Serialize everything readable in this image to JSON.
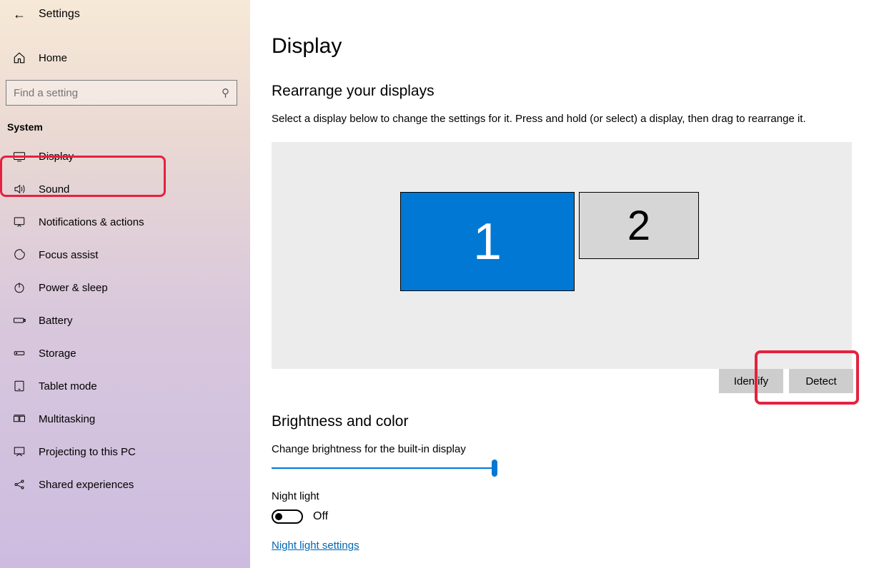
{
  "app": {
    "title": "Settings"
  },
  "sidebar": {
    "home": "Home",
    "search_placeholder": "Find a setting",
    "category": "System",
    "items": [
      {
        "label": "Display"
      },
      {
        "label": "Sound"
      },
      {
        "label": "Notifications & actions"
      },
      {
        "label": "Focus assist"
      },
      {
        "label": "Power & sleep"
      },
      {
        "label": "Battery"
      },
      {
        "label": "Storage"
      },
      {
        "label": "Tablet mode"
      },
      {
        "label": "Multitasking"
      },
      {
        "label": "Projecting to this PC"
      },
      {
        "label": "Shared experiences"
      }
    ]
  },
  "main": {
    "title": "Display",
    "rearrange_title": "Rearrange your displays",
    "rearrange_desc": "Select a display below to change the settings for it. Press and hold (or select) a display, then drag to rearrange it.",
    "monitor1": "1",
    "monitor2": "2",
    "identify": "Identify",
    "detect": "Detect",
    "brightness_title": "Brightness and color",
    "brightness_label": "Change brightness for the built-in display",
    "brightness_value": 100,
    "night_light_label": "Night light",
    "night_light_state": "Off",
    "night_light_link": "Night light settings"
  }
}
